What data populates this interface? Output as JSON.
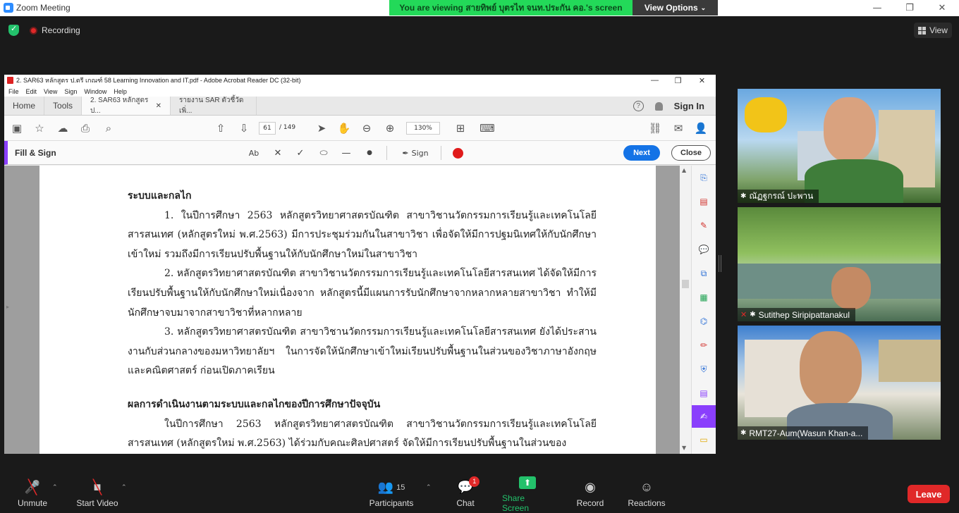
{
  "zoom": {
    "window_title": "Zoom Meeting",
    "viewing_banner": "You are viewing สายทิพย์ บุตรไท จนท.ประกัน คอ.'s screen",
    "view_options_label": "View Options",
    "recording_label": "Recording",
    "view_label": "View",
    "controls": {
      "unmute": "Unmute",
      "start_video": "Start Video",
      "participants": "Participants",
      "participants_count": "15",
      "chat": "Chat",
      "chat_badge": "1",
      "share_screen": "Share Screen",
      "record": "Record",
      "reactions": "Reactions",
      "leave": "Leave"
    },
    "participants": [
      {
        "name": "ณัฏฐกรณ์ ปะพาน"
      },
      {
        "name": "Sutithep Siripipattanakul"
      },
      {
        "name": "RMT27-Aum(Wasun Khan-a..."
      }
    ],
    "colors": {
      "share_green": "#23c16b",
      "leave_red": "#e02828",
      "banner_green": "#23d959"
    }
  },
  "acrobat": {
    "window_title": "2. SAR63 หลักสูตร ป.ตรี เกณฑ์ 58 Learning Innovation and IT.pdf - Adobe Acrobat Reader DC (32-bit)",
    "menu": [
      "File",
      "Edit",
      "View",
      "Sign",
      "Window",
      "Help"
    ],
    "tabs": {
      "home": "Home",
      "tools": "Tools",
      "doc1": "2. SAR63 หลักสูตร ป...",
      "doc2": "รายงาน SAR ตัวชี้วัดเพิ่..."
    },
    "sign_in": "Sign In",
    "page_current": "61",
    "page_total": "/ 149",
    "zoom_level": "130%",
    "fill_sign": {
      "label": "Fill & Sign",
      "sign_label": "Sign",
      "next": "Next",
      "close": "Close"
    },
    "colors": {
      "accent_purple": "#8a3ffc",
      "next_blue": "#1473e6",
      "ink_red": "#e01b1b"
    },
    "document": {
      "heading1": "ระบบและกลไก",
      "para1": "1. ในปีการศึกษา 2563  หลักสูตรวิทยาศาสตรบัณฑิต  สาขาวิชานวัตกรรมการเรียนรู้และเทคโนโลยีสารสนเทศ (หลักสูตรใหม่ พ.ศ.2563)  มีการประชุมร่วมกันในสาขาวิชา   เพื่อจัดให้มีการปฐมนิเทศให้กับนักศึกษาเข้าใหม่   รวมถึงมีการเรียนปรับพื้นฐานให้กับนักศึกษาใหม่ในสาขาวิชา",
      "para2": "2. หลักสูตรวิทยาศาสตรบัณฑิต  สาขาวิชานวัตกรรมการเรียนรู้และเทคโนโลยีสารสนเทศ ได้จัดให้มีการเรียนปรับพื้นฐานให้กับนักศึกษาใหม่เนื่องจาก  หลักสูตรนี้มีแผนการรับนักศึกษาจากหลากหลายสาขาวิชา ทำให้มีนักศึกษาจบมาจากสาขาวิชาที่หลากหลาย",
      "para3": "3. หลักสูตรวิทยาศาสตรบัณฑิต  สาขาวิชานวัตกรรมการเรียนรู้และเทคโนโลยีสารสนเทศ ยังได้ประสานงานกับส่วนกลางของมหาวิทยาลัยฯ  ในการจัดให้นักศึกษาเข้าใหม่เรียนปรับพื้นฐานในส่วนของวิชาภาษาอังกฤษ และคณิตศาสตร์  ก่อนเปิดภาคเรียน",
      "heading2": "ผลการดำเนินงานตามระบบและกลไกของปีการศึกษาปัจจุบัน",
      "para4": "ในปีการศึกษา 2563  หลักสูตรวิทยาศาสตรบัณฑิต  สาขาวิชานวัตกรรมการเรียนรู้และเทคโนโลยีสารสนเทศ (หลักสูตรใหม่ พ.ศ.2563)  ได้ร่วมกับคณะศิลปศาสตร์ จัดให้มีการเรียนปรับพื้นฐานในส่วนของ"
    }
  }
}
